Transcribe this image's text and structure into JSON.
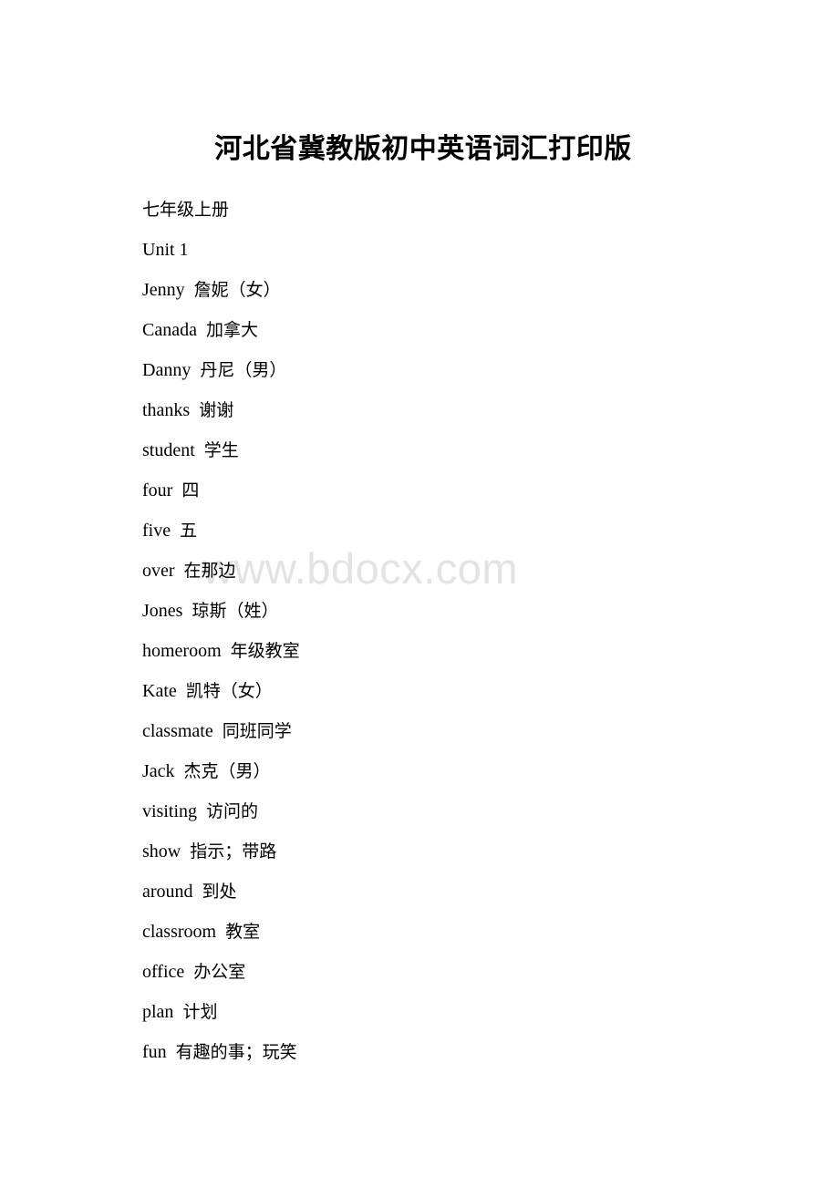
{
  "document": {
    "title": "河北省冀教版初中英语词汇打印版",
    "grade_section": "七年级上册",
    "unit_heading": "Unit 1"
  },
  "watermark": {
    "text": "www.bdocx.com",
    "color": "#e3e3e3"
  },
  "vocabulary": [
    {
      "term": "Jenny",
      "gloss": "詹妮（女）"
    },
    {
      "term": "Canada",
      "gloss": "加拿大"
    },
    {
      "term": "Danny",
      "gloss": "丹尼（男）"
    },
    {
      "term": "thanks",
      "gloss": "谢谢"
    },
    {
      "term": "student",
      "gloss": "学生"
    },
    {
      "term": "four",
      "gloss": "四"
    },
    {
      "term": "five",
      "gloss": "五"
    },
    {
      "term": "over",
      "gloss": "在那边"
    },
    {
      "term": "Jones",
      "gloss": "琼斯（姓）"
    },
    {
      "term": "homeroom",
      "gloss": "年级教室"
    },
    {
      "term": "Kate",
      "gloss": "凯特（女）"
    },
    {
      "term": "classmate",
      "gloss": "同班同学"
    },
    {
      "term": "Jack",
      "gloss": "杰克（男）"
    },
    {
      "term": "visiting",
      "gloss": "访问的"
    },
    {
      "term": "show",
      "gloss": "指示；带路"
    },
    {
      "term": "around",
      "gloss": "到处"
    },
    {
      "term": "classroom",
      "gloss": "教室"
    },
    {
      "term": "office",
      "gloss": "办公室"
    },
    {
      "term": "plan",
      "gloss": "计划"
    },
    {
      "term": "fun",
      "gloss": "有趣的事；玩笑"
    }
  ]
}
